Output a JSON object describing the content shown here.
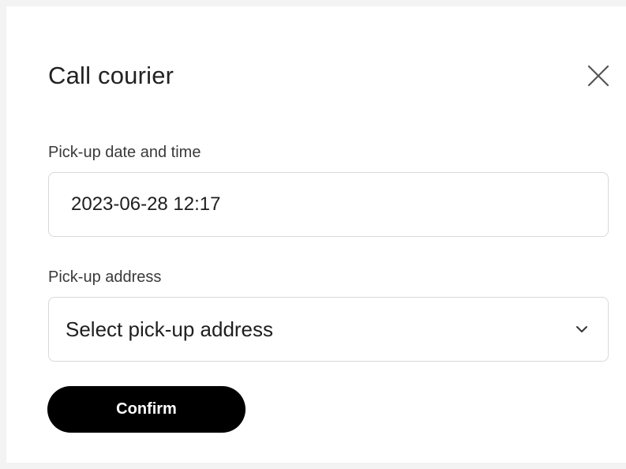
{
  "dialog": {
    "title": "Call courier",
    "close_icon": "close-icon"
  },
  "form": {
    "date_label": "Pick-up date and time",
    "date_value": "2023-06-28 12:17",
    "address_label": "Pick-up address",
    "address_placeholder": "Select pick-up address",
    "address_icon": "chevron-down-icon"
  },
  "actions": {
    "confirm_label": "Confirm"
  },
  "colors": {
    "background": "#ffffff",
    "border": "#d9d9d9",
    "button_bg": "#000000",
    "button_text": "#ffffff"
  }
}
